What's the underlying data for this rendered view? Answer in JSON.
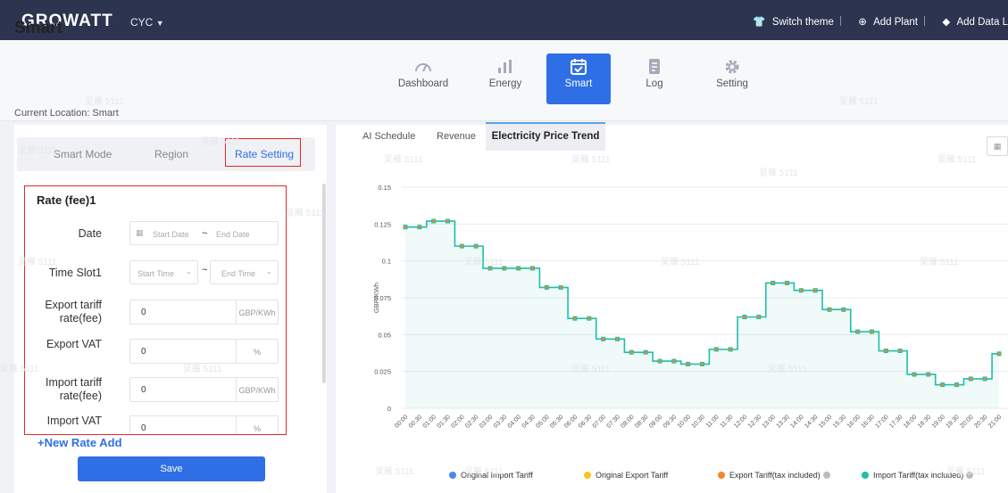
{
  "topbar": {
    "logo": "GROWATT",
    "plant": "CYC",
    "switch_theme": "Switch theme",
    "add_plant": "Add Plant",
    "add_datalogger": "Add Data L"
  },
  "page": {
    "title": "Smart",
    "location": "Current Location: Smart",
    "watermark": "吴雁 5111"
  },
  "nav": [
    {
      "label": "Dashboard",
      "icon": "gauge-icon"
    },
    {
      "label": "Energy",
      "icon": "bar-chart-icon"
    },
    {
      "label": "Smart",
      "icon": "calendar-icon"
    },
    {
      "label": "Log",
      "icon": "document-icon"
    },
    {
      "label": "Setting",
      "icon": "gear-icon"
    }
  ],
  "left_tabs": [
    "Smart Mode",
    "Region",
    "Rate Setting"
  ],
  "form": {
    "title": "Rate (fee)1",
    "date_label": "Date",
    "start_date": "Start Date",
    "tilde": "~",
    "end_date": "End Date",
    "timeslot_label": "Time Slot1",
    "start_time": "Start Time",
    "end_time": "End Time",
    "export_tariff_label_1": "Export tariff",
    "export_tariff_label_2": "rate(fee)",
    "export_tariff_value": "0",
    "export_tariff_unit": "GBP/KWh",
    "export_vat_label": "Export VAT",
    "export_vat_value": "0",
    "export_vat_unit": "%",
    "import_tariff_label_1": "Import tariff",
    "import_tariff_label_2": "rate(fee)",
    "import_tariff_value": "0",
    "import_tariff_unit": "GBP/KWh",
    "import_vat_label": "Import VAT",
    "import_vat_value": "0",
    "import_vat_unit": "%",
    "new_rate": "+New Rate Add",
    "save": "Save"
  },
  "right_tabs": [
    "AI Schedule",
    "Revenue",
    "Electricity Price Trend"
  ],
  "colors": {
    "accent": "#2f6fe6",
    "topbar": "#2d3450",
    "highlight": "#e02a2a",
    "import_line": "#1dbfa8",
    "export_marker": "#f5872c"
  },
  "chart_data": {
    "type": "line",
    "ylabel": "GBP/KWh",
    "ylim": [
      0,
      0.15
    ],
    "yticks": [
      "0",
      "0.025",
      "0.05",
      "0.075",
      "0.1",
      "0.125",
      "0.15"
    ],
    "step": "after",
    "grid": true,
    "legend_position": "bottom",
    "x": [
      "00:00",
      "00:30",
      "01:00",
      "01:30",
      "02:00",
      "02:30",
      "03:00",
      "03:30",
      "04:00",
      "04:30",
      "05:00",
      "05:30",
      "06:00",
      "06:30",
      "07:00",
      "07:30",
      "08:00",
      "08:30",
      "09:00",
      "09:30",
      "10:00",
      "10:30",
      "11:00",
      "11:30",
      "12:00",
      "12:30",
      "13:00",
      "13:30",
      "14:00",
      "14:30",
      "15:00",
      "15:30",
      "16:00",
      "16:30",
      "17:00",
      "17:30",
      "18:00",
      "18:30",
      "19:00",
      "19:30",
      "20:00",
      "20:30",
      "21:00"
    ],
    "series": [
      {
        "name": "Import Tariff(tax included)",
        "color": "#1dbfa8",
        "values": [
          0.123,
          0.123,
          0.127,
          0.127,
          0.11,
          0.11,
          0.095,
          0.095,
          0.095,
          0.095,
          0.082,
          0.082,
          0.061,
          0.061,
          0.047,
          0.047,
          0.038,
          0.038,
          0.032,
          0.032,
          0.03,
          0.03,
          0.04,
          0.04,
          0.062,
          0.062,
          0.085,
          0.085,
          0.08,
          0.08,
          0.067,
          0.067,
          0.052,
          0.052,
          0.039,
          0.039,
          0.023,
          0.023,
          0.016,
          0.016,
          0.02,
          0.02,
          0.037
        ]
      },
      {
        "name": "Export Tariff(tax included)",
        "color": "#f5872c",
        "values": [
          0.123,
          0.123,
          0.127,
          0.127,
          0.11,
          0.11,
          0.095,
          0.095,
          0.095,
          0.095,
          0.082,
          0.082,
          0.061,
          0.061,
          0.047,
          0.047,
          0.038,
          0.038,
          0.032,
          0.032,
          0.03,
          0.03,
          0.04,
          0.04,
          0.062,
          0.062,
          0.085,
          0.085,
          0.08,
          0.08,
          0.067,
          0.067,
          0.052,
          0.052,
          0.039,
          0.039,
          0.023,
          0.023,
          0.016,
          0.016,
          0.02,
          0.02,
          0.037
        ]
      }
    ],
    "legend": [
      {
        "name": "Original Import Tariff",
        "color": "#4f86ec",
        "info": false
      },
      {
        "name": "Original Export Tariff",
        "color": "#f7c51a",
        "info": false
      },
      {
        "name": "Export Tariff(tax included)",
        "color": "#f5872c",
        "info": true
      },
      {
        "name": "Import Tariff(tax included)",
        "color": "#1dbfa8",
        "info": true
      }
    ]
  }
}
